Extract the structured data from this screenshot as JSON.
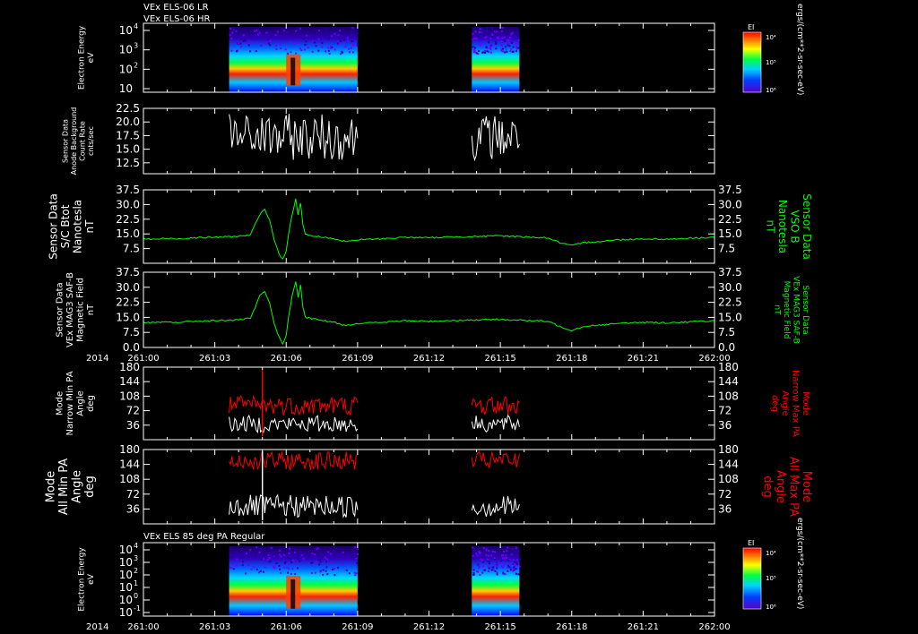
{
  "header": {
    "line1": "VEx ELS-06 LR",
    "line2": "VEx ELS-06 HR",
    "panel7_title": "VEx ELS 85 deg PA Regular"
  },
  "colors": {
    "background": "#000000",
    "axis": "#ffffff",
    "white_trace": "#ffffff",
    "green_trace": "#00ff00",
    "red_trace": "#ff0000"
  },
  "time_axis": {
    "year": "2014",
    "range": [
      "261:00",
      "262:00"
    ],
    "tick_labels": [
      "261:00",
      "261:03",
      "261:06",
      "261:09",
      "261:12",
      "261:15",
      "261:18",
      "261:21",
      "262:00"
    ]
  },
  "colorbar": {
    "label": "EI",
    "unit": "ergs/(cm**2-sr-sec-eV)",
    "tick_labels": [
      "10⁴",
      "10⁵",
      "10⁶"
    ]
  },
  "chart_data": [
    {
      "type": "heatmap",
      "panel": "electron-spectrogram-hr",
      "ylabel": [
        "Electron Energy",
        "eV"
      ],
      "yscale": "log",
      "ytick_labels": [
        [
          "10",
          "4"
        ],
        [
          "10",
          "3"
        ],
        [
          "10",
          "2"
        ],
        [
          "10",
          ""
        ]
      ],
      "data_windows": [
        [
          "261:03.6",
          "261:09.0"
        ],
        [
          "261:13.8",
          "261:15.8"
        ]
      ]
    },
    {
      "type": "line",
      "panel": "anode-background",
      "ylabel": [
        "Sensor Data",
        "Anode Background",
        "Count Rate",
        "cnts/sec"
      ],
      "ylim": [
        10.5,
        22.5
      ],
      "ytick_labels": [
        "22.5",
        "20.0",
        "17.5",
        "15.0",
        "12.5"
      ],
      "series": [
        {
          "color": "white",
          "segments": [
            [
              "261:03.6",
              "261:09.0"
            ],
            [
              "261:13.8",
              "261:15.8"
            ]
          ],
          "typical_range": [
            13.0,
            21.5
          ]
        }
      ]
    },
    {
      "type": "line",
      "panel": "sc-btot",
      "ylabel_left": [
        "Sensor Data",
        "S/C Btot",
        "Nanotesla",
        "nT"
      ],
      "ylabel_right": [
        "Sensor Data",
        "VSO B",
        "Nanotesla",
        "nT"
      ],
      "ylim": [
        0,
        37.5
      ],
      "ytick_labels": [
        "37.5",
        "30.0",
        "22.5",
        "15.0",
        "7.5"
      ],
      "series": [
        {
          "color": "green",
          "points": [
            [
              0,
              12.5
            ],
            [
              0.5,
              12.3
            ],
            [
              1,
              12.7
            ],
            [
              1.5,
              12.5
            ],
            [
              2,
              13.0
            ],
            [
              2.5,
              13.2
            ],
            [
              3,
              13.3
            ],
            [
              3.5,
              13.5
            ],
            [
              4,
              13.8
            ],
            [
              4.5,
              14.5
            ],
            [
              4.7,
              20
            ],
            [
              4.9,
              25
            ],
            [
              5.1,
              27.5
            ],
            [
              5.3,
              22
            ],
            [
              5.5,
              12
            ],
            [
              5.7,
              5
            ],
            [
              5.85,
              2
            ],
            [
              6.0,
              6
            ],
            [
              6.1,
              15
            ],
            [
              6.25,
              25
            ],
            [
              6.4,
              33
            ],
            [
              6.5,
              25
            ],
            [
              6.6,
              31
            ],
            [
              6.7,
              20
            ],
            [
              6.8,
              15
            ],
            [
              7,
              14
            ],
            [
              7.5,
              13.5
            ],
            [
              8,
              12.5
            ],
            [
              8.5,
              11.0
            ],
            [
              9,
              12.0
            ],
            [
              10,
              12.5
            ],
            [
              11,
              13.3
            ],
            [
              12,
              13.0
            ],
            [
              13,
              13.5
            ],
            [
              14,
              13.7
            ],
            [
              15,
              14.0
            ],
            [
              16,
              13.5
            ],
            [
              17,
              13.0
            ],
            [
              17.5,
              10.5
            ],
            [
              18,
              9.0
            ],
            [
              18.5,
              10.5
            ],
            [
              19,
              11.0
            ],
            [
              20,
              12.0
            ],
            [
              21,
              12.5
            ],
            [
              22,
              12.3
            ],
            [
              23,
              12.8
            ],
            [
              24,
              13.3
            ]
          ]
        }
      ]
    },
    {
      "type": "line",
      "panel": "mag3-saf-b",
      "ylabel_left": [
        "Sensor Data",
        "VEx MAG3 SAF-B",
        "Magnetic Field",
        "nT"
      ],
      "ylabel_right": [
        "Sensor Data",
        "VEx MAG3 SAF-B",
        "Magnetic Field",
        "nT"
      ],
      "ylim": [
        0,
        37.5
      ],
      "ytick_labels": [
        "37.5",
        "30.0",
        "22.5",
        "15.0",
        "7.5",
        "0.0"
      ],
      "series": [
        {
          "color": "green",
          "points": [
            [
              0,
              12.5
            ],
            [
              0.5,
              12.3
            ],
            [
              1,
              12.7
            ],
            [
              1.5,
              12.5
            ],
            [
              2,
              13.0
            ],
            [
              2.5,
              13.2
            ],
            [
              3,
              13.3
            ],
            [
              3.5,
              13.5
            ],
            [
              4,
              13.8
            ],
            [
              4.5,
              14.5
            ],
            [
              4.7,
              20
            ],
            [
              4.9,
              26
            ],
            [
              5.1,
              28
            ],
            [
              5.3,
              22
            ],
            [
              5.5,
              12
            ],
            [
              5.7,
              5
            ],
            [
              5.85,
              2
            ],
            [
              6.0,
              6
            ],
            [
              6.1,
              15
            ],
            [
              6.25,
              26
            ],
            [
              6.4,
              33
            ],
            [
              6.5,
              25
            ],
            [
              6.6,
              31
            ],
            [
              6.7,
              20
            ],
            [
              6.8,
              15
            ],
            [
              7,
              14.5
            ],
            [
              7.5,
              13.5
            ],
            [
              8,
              12.5
            ],
            [
              8.5,
              11.0
            ],
            [
              9,
              12.0
            ],
            [
              10,
              12.5
            ],
            [
              11,
              13.3
            ],
            [
              12,
              13.0
            ],
            [
              13,
              13.5
            ],
            [
              14,
              13.7
            ],
            [
              15,
              14.0
            ],
            [
              16,
              13.5
            ],
            [
              17,
              13.0
            ],
            [
              17.5,
              10.5
            ],
            [
              18,
              8.5
            ],
            [
              18.5,
              10.5
            ],
            [
              19,
              11.0
            ],
            [
              20,
              12.0
            ],
            [
              21,
              12.5
            ],
            [
              22,
              12.3
            ],
            [
              23,
              12.8
            ],
            [
              24,
              13.3
            ]
          ]
        }
      ]
    },
    {
      "type": "line",
      "panel": "narrow-pa",
      "ylabel_left": [
        "Mode",
        "Narrow Min PA",
        "Angle",
        "deg"
      ],
      "ylabel_right": [
        "Mode",
        "Narrow Max PA",
        "Angle",
        "deg"
      ],
      "ylim": [
        0,
        180
      ],
      "ytick_labels": [
        "180",
        "144",
        "108",
        "72",
        "36"
      ],
      "series": [
        {
          "color": "red",
          "segments": [
            [
              "261:03.6",
              "261:09.0"
            ],
            [
              "261:13.8",
              "261:15.8"
            ]
          ],
          "typical_range": [
            60,
            110
          ]
        },
        {
          "color": "white",
          "segments": [
            [
              "261:03.6",
              "261:09.0"
            ],
            [
              "261:13.8",
              "261:15.8"
            ]
          ],
          "typical_range": [
            18,
            60
          ]
        }
      ]
    },
    {
      "type": "line",
      "panel": "all-pa",
      "ylabel_left": [
        "Mode",
        "All Min PA",
        "Angle",
        "deg"
      ],
      "ylabel_right": [
        "Mode",
        "All Max PA",
        "Angle",
        "deg"
      ],
      "ylim": [
        0,
        180
      ],
      "ytick_labels": [
        "180",
        "144",
        "108",
        "72",
        "36"
      ],
      "series": [
        {
          "color": "red",
          "segments": [
            [
              "261:03.6",
              "261:09.0"
            ],
            [
              "261:13.8",
              "261:15.8"
            ]
          ],
          "typical_range": [
            130,
            175
          ]
        },
        {
          "color": "white",
          "segments": [
            [
              "261:03.6",
              "261:09.0"
            ],
            [
              "261:13.8",
              "261:15.8"
            ]
          ],
          "typical_range": [
            15,
            70
          ]
        }
      ]
    },
    {
      "type": "heatmap",
      "panel": "electron-spectrogram-85pa",
      "ylabel": [
        "Electron Energy",
        "eV"
      ],
      "yscale": "log",
      "ytick_labels": [
        [
          "10",
          "4"
        ],
        [
          "10",
          "3"
        ],
        [
          "10",
          "2"
        ],
        [
          "10",
          "1"
        ],
        [
          "10",
          "0"
        ],
        [
          "10",
          "-1"
        ]
      ],
      "data_windows": [
        [
          "261:03.6",
          "261:09.0"
        ],
        [
          "261:13.8",
          "261:15.8"
        ]
      ]
    }
  ]
}
